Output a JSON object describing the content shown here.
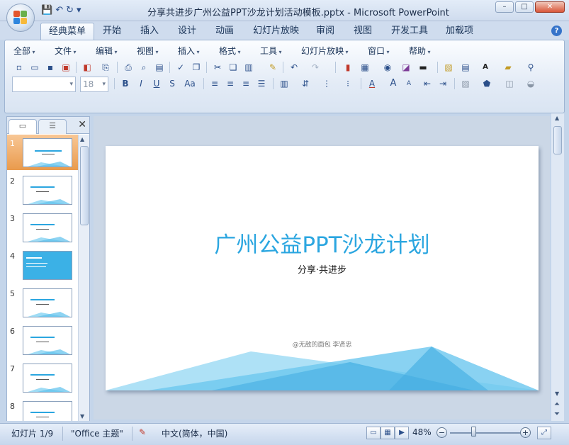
{
  "window": {
    "title": "分享共进步广州公益PPT沙龙计划活动模板.pptx - Microsoft PowerPoint",
    "buttons": {
      "minimize": "–",
      "maximize": "□",
      "close": "✕"
    }
  },
  "quick_access": {
    "save_icon": "💾",
    "undo_icon": "↶",
    "redo_icon": "↻",
    "customize_icon": "▾"
  },
  "tabs": [
    "经典菜单",
    "开始",
    "插入",
    "设计",
    "动画",
    "幻灯片放映",
    "审阅",
    "视图",
    "开发工具",
    "加载项"
  ],
  "active_tab": "经典菜单",
  "help": "?",
  "menubar": [
    "全部",
    "文件",
    "编辑",
    "视图",
    "插入",
    "格式",
    "工具",
    "幻灯片放映",
    "窗口",
    "帮助"
  ],
  "font_combo": {
    "font": "",
    "size": "18"
  },
  "format_buttons": {
    "bold": "B",
    "italic": "I",
    "underline": "U",
    "shadow": "S",
    "case": "Aa",
    "font_color": "A",
    "grow": "A",
    "shrink": "A"
  },
  "panel": {
    "tab_slides_icon": "▭",
    "tab_outline_icon": "☰",
    "close": "✕"
  },
  "slides": [
    {
      "num": "1",
      "selected": true
    },
    {
      "num": "2",
      "selected": false
    },
    {
      "num": "3",
      "selected": false
    },
    {
      "num": "4",
      "selected": false
    },
    {
      "num": "5",
      "selected": false
    },
    {
      "num": "6",
      "selected": false
    },
    {
      "num": "7",
      "selected": false
    },
    {
      "num": "8",
      "selected": false
    }
  ],
  "slide": {
    "title": "广州公益PPT沙龙计划",
    "subtitle": "分享·共进步",
    "author": "@无敌的面包  李贤忠"
  },
  "status": {
    "slide_indicator": "幻灯片 1/9",
    "theme": "\"Office 主题\"",
    "language": "中文(简体，中国)",
    "zoom": "48%",
    "zoom_level": 0.34,
    "zoom_out": "−",
    "zoom_in": "+"
  },
  "colors": {
    "accent": "#2ba6e0",
    "selection": "#e99a4c"
  }
}
